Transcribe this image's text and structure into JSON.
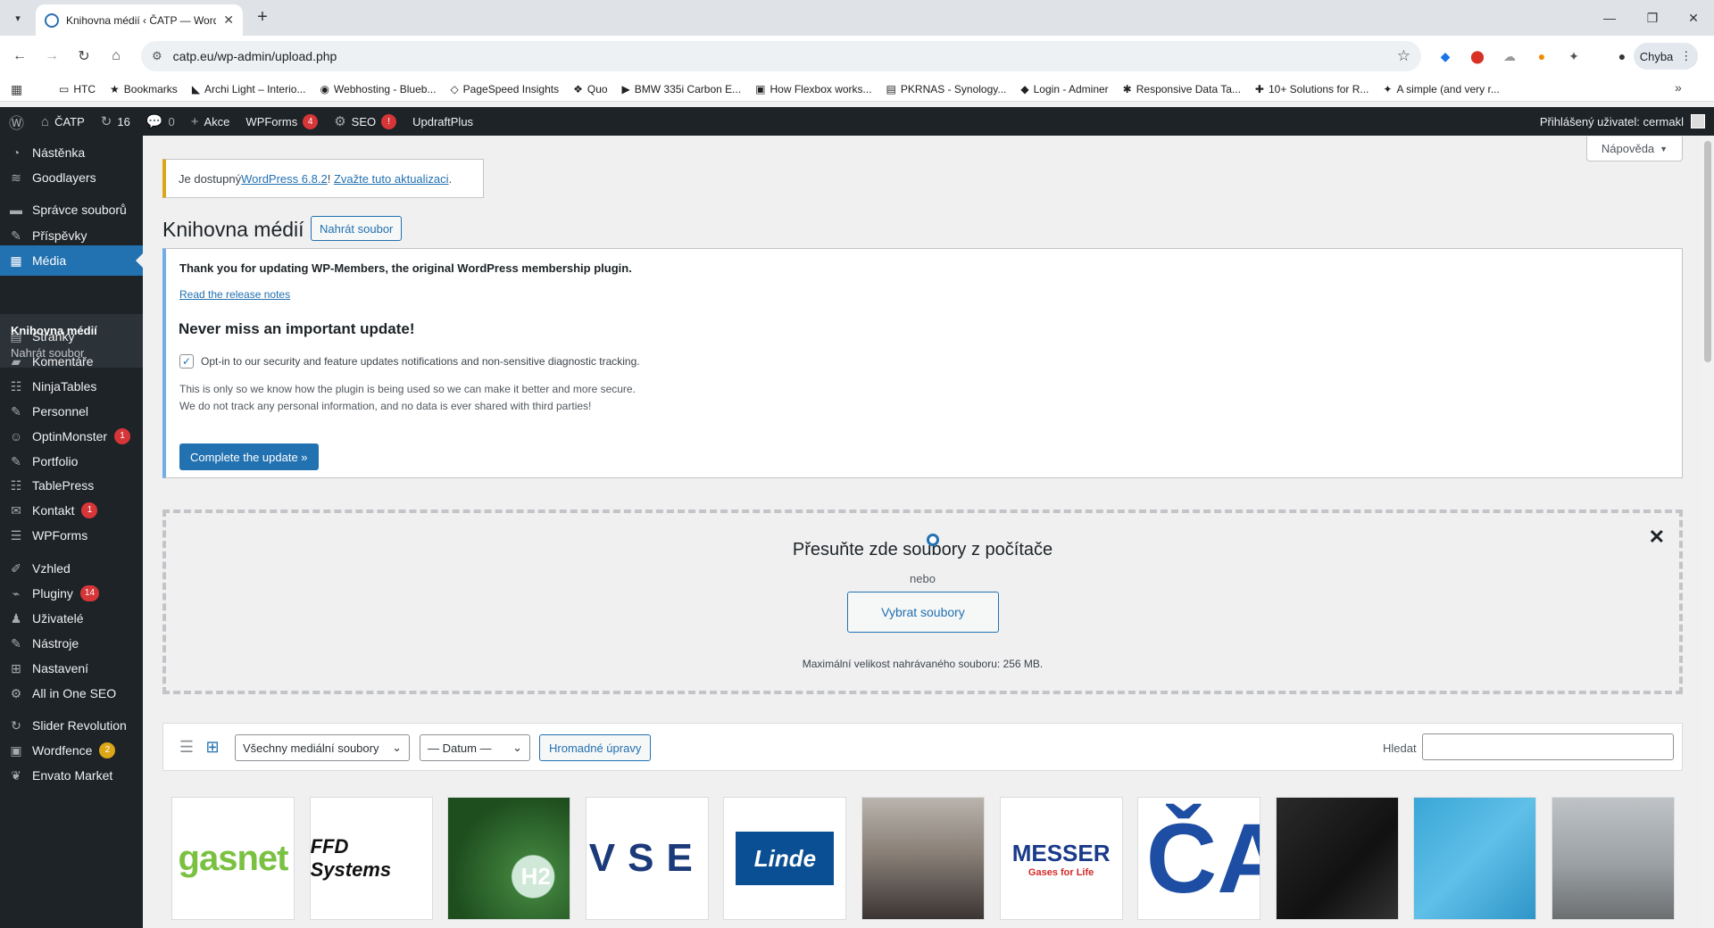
{
  "browser": {
    "tab_title": "Knihovna médií ‹ ČATP — Word",
    "url": "catp.eu/wp-admin/upload.php",
    "profile_label": "Chyba",
    "bookmarks": [
      "HTC",
      "Bookmarks",
      "Archi Light – Interio...",
      "Webhosting - Blueb...",
      "PageSpeed Insights",
      "Quo",
      "BMW 335i Carbon E...",
      "How Flexbox works...",
      "PKRNAS - Synology...",
      "Login - Adminer",
      "Responsive Data Ta...",
      "10+ Solutions for R...",
      "A simple (and very r..."
    ]
  },
  "adminbar": {
    "site": "ČATP",
    "updates": "16",
    "comments": "0",
    "new": "Akce",
    "wpforms": "WPForms",
    "wpforms_badge": "4",
    "seo": "SEO",
    "seo_badge": "!",
    "updraft": "UpdraftPlus",
    "user": "Přihlášený uživatel: cermakl"
  },
  "sidebar": {
    "items": [
      {
        "label": "Nástěnka",
        "icon": "dashboard-icon"
      },
      {
        "label": "Goodlayers",
        "icon": "layers-icon"
      },
      {
        "label": "Správce souborů",
        "icon": "folder-icon"
      },
      {
        "label": "Příspěvky",
        "icon": "pin-icon"
      },
      {
        "label": "Média",
        "icon": "media-icon"
      },
      {
        "label": "Stránky",
        "icon": "pages-icon"
      },
      {
        "label": "Komentáře",
        "icon": "comment-icon"
      },
      {
        "label": "NinjaTables",
        "icon": "table-icon"
      },
      {
        "label": "Personnel",
        "icon": "pin-icon"
      },
      {
        "label": "OptinMonster",
        "icon": "monster-icon",
        "badge": "1"
      },
      {
        "label": "Portfolio",
        "icon": "pin-icon"
      },
      {
        "label": "TablePress",
        "icon": "table-icon"
      },
      {
        "label": "Kontakt",
        "icon": "mail-icon",
        "badge": "1"
      },
      {
        "label": "WPForms",
        "icon": "forms-icon"
      },
      {
        "label": "Vzhled",
        "icon": "brush-icon"
      },
      {
        "label": "Pluginy",
        "icon": "plugin-icon",
        "badge": "14"
      },
      {
        "label": "Uživatelé",
        "icon": "user-icon"
      },
      {
        "label": "Nástroje",
        "icon": "wrench-icon"
      },
      {
        "label": "Nastavení",
        "icon": "settings-icon"
      },
      {
        "label": "All in One SEO",
        "icon": "seo-icon"
      },
      {
        "label": "Slider Revolution",
        "icon": "refresh-icon"
      },
      {
        "label": "Wordfence",
        "icon": "shield-icon",
        "badge": "2"
      },
      {
        "label": "Envato Market",
        "icon": "leaf-icon"
      }
    ],
    "submenu": [
      "Knihovna médií",
      "Nahrát soubor"
    ]
  },
  "help_tab": "Nápověda",
  "update_nag": {
    "prefix": "Je dostupný ",
    "link1": "WordPress 6.8.2",
    "middle": "! ",
    "link2": "Zvažte tuto aktualizaci",
    "suffix": "."
  },
  "page": {
    "title": "Knihovna médií",
    "action": "Nahrát soubor"
  },
  "wpm_notice": {
    "thanks": "Thank you for updating WP-Members, the original WordPress membership plugin.",
    "release_link": "Read the release notes",
    "heading": "Never miss an important update!",
    "optin": "Opt-in to our security and feature updates notifications and non-sensitive diagnostic tracking.",
    "optin_checked": true,
    "p1": "This is only so we know how the plugin is being used so we can make it better and more secure.",
    "p2": "We do not track any personal information, and no data is ever shared with third parties!",
    "button": "Complete the update »"
  },
  "uploader": {
    "headline": "Přesuňte zde soubory z počítače",
    "or": "nebo",
    "button": "Vybrat soubory",
    "max_size": "Maximální velikost nahrávaného souboru: 256 MB."
  },
  "media_toolbar": {
    "filter_type": "Všechny mediální soubory",
    "filter_date": "— Datum —",
    "bulk": "Hromadné úpravy",
    "search_label": "Hledat",
    "search_value": ""
  },
  "thumbnails": [
    {
      "label": "gasnet",
      "kind": "logo-gasnet"
    },
    {
      "label": "FFD Systems",
      "kind": "logo-ffd"
    },
    {
      "label": "H2",
      "kind": "photo-h2"
    },
    {
      "label": "VSE",
      "kind": "logo-vse"
    },
    {
      "label": "Linde",
      "kind": "logo-linde"
    },
    {
      "label": "",
      "kind": "photo-press"
    },
    {
      "label": "MESSER",
      "sublabel": "Gases for Life",
      "kind": "logo-messer"
    },
    {
      "label": "ČA",
      "kind": "logo-ca"
    },
    {
      "label": "",
      "kind": "photo-dark"
    },
    {
      "label": "",
      "kind": "photo-blue"
    },
    {
      "label": "",
      "kind": "photo-tank"
    }
  ],
  "colors": {
    "admin_dark": "#1d2327",
    "accent_blue": "#2271b1",
    "badge_red": "#d63638",
    "nag_yellow": "#dba617"
  }
}
